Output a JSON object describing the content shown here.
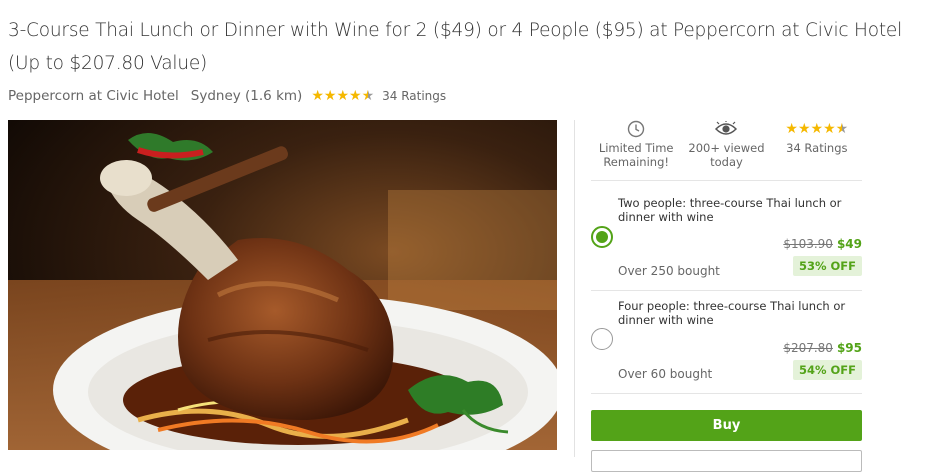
{
  "deal": {
    "title": "3-Course Thai Lunch or Dinner with Wine for 2 ($49) or 4 People ($95) at Peppercorn at Civic Hotel (Up to $207.80 Value)",
    "merchant": "Peppercorn at Civic Hotel",
    "location": "Sydney (1.6 km)",
    "rating": 4.5,
    "ratings_count": "34 Ratings"
  },
  "image": {
    "icon": "food-photo",
    "subject": "braised pork knuckle"
  },
  "info": {
    "limited": "Limited Time Remaining!",
    "viewed": "200+ viewed today",
    "ratings": "34 Ratings"
  },
  "options": [
    {
      "title": "Two people: three-course Thai lunch or dinner with wine",
      "original_price": "$103.90",
      "price": "$49",
      "bought": "Over 250 bought",
      "discount": "53% OFF",
      "selected": true
    },
    {
      "title": "Four people: three-course Thai lunch or dinner with wine",
      "original_price": "$207.80",
      "price": "$95",
      "bought": "Over 60 bought",
      "discount": "54% OFF",
      "selected": false
    }
  ],
  "buy_label": "Buy",
  "colors": {
    "accent": "#53a318",
    "star": "#f5b800"
  }
}
